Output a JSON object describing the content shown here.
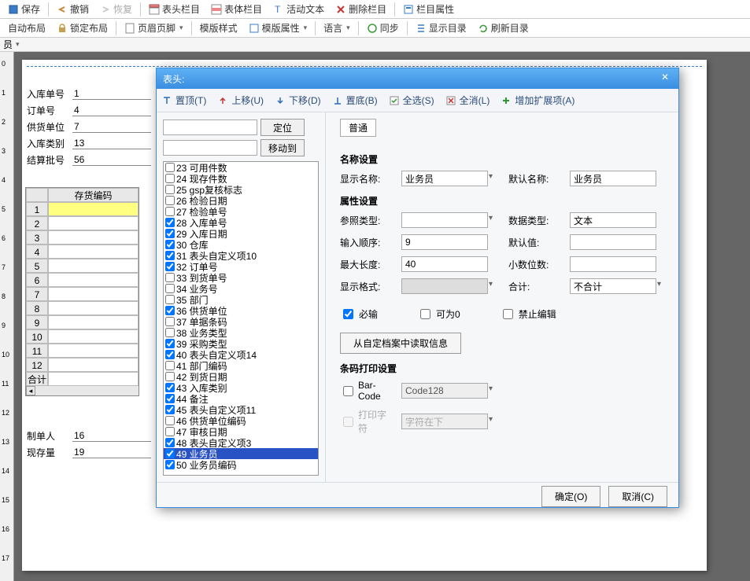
{
  "toolbar1": {
    "save": "保存",
    "undo": "撤销",
    "redo": "恢复",
    "headerCol": "表头栏目",
    "bodyCol": "表体栏目",
    "activeText": "活动文本",
    "deleteCol": "删除栏目",
    "colProps": "栏目属性"
  },
  "toolbar2": {
    "autoLayout": "自动布局",
    "lockLayout": "锁定布局",
    "headerFooter": "页眉页脚",
    "tplStyle": "模版样式",
    "tplProps": "模版属性",
    "language": "语言",
    "sync": "同步",
    "showToc": "显示目录",
    "refreshToc": "刷新目录"
  },
  "miniLabel": "员",
  "form": {
    "f1": {
      "label": "入库单号",
      "value": "1"
    },
    "f2": {
      "label": "订单号",
      "value": "4"
    },
    "f3": {
      "label": "供货单位",
      "value": "7"
    },
    "f4": {
      "label": "入库类别",
      "value": "13"
    },
    "f5": {
      "label": "结算批号",
      "value": "56"
    }
  },
  "grid": {
    "colHeader": "存货编码",
    "sumLabel": "合计"
  },
  "bottom": {
    "b1": {
      "label": "制单人",
      "value": "16"
    },
    "b2": {
      "label": "现存量",
      "value": "19"
    }
  },
  "dialog": {
    "title": "表头:",
    "tb": {
      "top": "置顶(T)",
      "up": "上移(U)",
      "down": "下移(D)",
      "bottom": "置底(B)",
      "selAll": "全选(S)",
      "selNone": "全消(L)",
      "addExt": "增加扩展项(A)"
    },
    "btnLocate": "定位",
    "btnMoveTo": "移动到",
    "list": [
      {
        "n": "23",
        "t": "可用件数",
        "c": false
      },
      {
        "n": "24",
        "t": "现存件数",
        "c": false
      },
      {
        "n": "25",
        "t": "gsp复核标志",
        "c": false
      },
      {
        "n": "26",
        "t": "检验日期",
        "c": false
      },
      {
        "n": "27",
        "t": "检验单号",
        "c": false
      },
      {
        "n": "28",
        "t": "入库单号",
        "c": true
      },
      {
        "n": "29",
        "t": "入库日期",
        "c": true
      },
      {
        "n": "30",
        "t": "仓库",
        "c": true
      },
      {
        "n": "31",
        "t": "表头自定义项10",
        "c": true
      },
      {
        "n": "32",
        "t": "订单号",
        "c": true
      },
      {
        "n": "33",
        "t": "到货单号",
        "c": false
      },
      {
        "n": "34",
        "t": "业务号",
        "c": false
      },
      {
        "n": "35",
        "t": "部门",
        "c": false
      },
      {
        "n": "36",
        "t": "供货单位",
        "c": true
      },
      {
        "n": "37",
        "t": "单据条码",
        "c": false
      },
      {
        "n": "38",
        "t": "业务类型",
        "c": false
      },
      {
        "n": "39",
        "t": "采购类型",
        "c": true
      },
      {
        "n": "40",
        "t": "表头自定义项14",
        "c": true
      },
      {
        "n": "41",
        "t": "部门编码",
        "c": false
      },
      {
        "n": "42",
        "t": "到货日期",
        "c": false
      },
      {
        "n": "43",
        "t": "入库类别",
        "c": true
      },
      {
        "n": "44",
        "t": "备注",
        "c": true
      },
      {
        "n": "45",
        "t": "表头自定义项11",
        "c": true
      },
      {
        "n": "46",
        "t": "供货单位编码",
        "c": false
      },
      {
        "n": "47",
        "t": "审核日期",
        "c": false
      },
      {
        "n": "48",
        "t": "表头自定义项3",
        "c": true
      },
      {
        "n": "49",
        "t": "业务员",
        "c": true,
        "sel": true
      },
      {
        "n": "50",
        "t": "业务员编码",
        "c": true
      }
    ],
    "tab": "普通",
    "nameSec": "名称设置",
    "dispNameL": "显示名称:",
    "dispNameV": "业务员",
    "defNameL": "默认名称:",
    "defNameV": "业务员",
    "propSec": "属性设置",
    "refTypeL": "参照类型:",
    "refTypeV": "",
    "dataTypeL": "数据类型:",
    "dataTypeV": "文本",
    "inputOrderL": "输入顺序:",
    "inputOrderV": "9",
    "defaultL": "默认值:",
    "defaultV": "",
    "maxLenL": "最大长度:",
    "maxLenV": "40",
    "decimalL": "小数位数:",
    "decimalV": "",
    "dispFmtL": "显示格式:",
    "dispFmtV": "",
    "sumL": "合计:",
    "sumV": "不合计",
    "chkRequired": "必输",
    "chkZero": "可为0",
    "chkNoEdit": "禁止编辑",
    "readInfoBtn": "从自定档案中读取信息",
    "barcodeSec": "条码打印设置",
    "barcodeL": "Bar-Code",
    "barcodeV": "Code128",
    "printCharL": "打印字符",
    "printCharV": "字符在下",
    "ok": "确定(O)",
    "cancel": "取消(C)"
  }
}
